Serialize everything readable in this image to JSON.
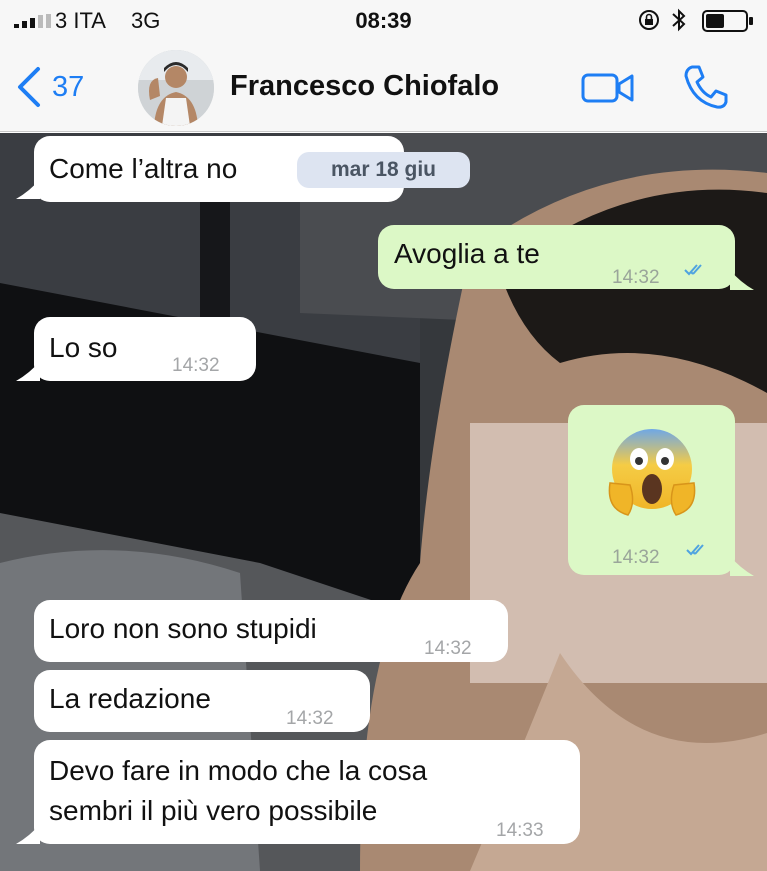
{
  "status_bar": {
    "carrier": "3 ITA",
    "network": "3G",
    "time": "08:39",
    "icons": [
      "signal-icon",
      "orientation-lock-icon",
      "bluetooth-icon",
      "battery-icon"
    ]
  },
  "nav": {
    "back_count": "37",
    "contact_name": "Francesco Chiofalo",
    "icons": [
      "chevron-left-icon",
      "video-call-icon",
      "phone-icon"
    ],
    "accent_color": "#1e7ef4"
  },
  "messages": [
    {
      "direction": "in",
      "text": "Come l’altra no",
      "date_label": "mar 18 giu"
    },
    {
      "direction": "out",
      "text": "Avoglia a te",
      "time": "14:32",
      "status": "read"
    },
    {
      "direction": "in",
      "text": "Lo so",
      "time": "14:32"
    },
    {
      "direction": "out",
      "emoji": "face-screaming-in-fear",
      "time": "14:32",
      "status": "read"
    },
    {
      "direction": "in",
      "text": "Loro non sono stupidi",
      "time": "14:32"
    },
    {
      "direction": "in",
      "text": "La redazione",
      "time": "14:32"
    },
    {
      "direction": "in",
      "text_lines": [
        "Devo fare in modo che la cosa",
        "sembri il più vero possibile"
      ],
      "time": "14:33"
    }
  ],
  "colors": {
    "incoming_bubble": "#ffffff",
    "outgoing_bubble": "#dcf8c6",
    "read_tick": "#4fa3e0",
    "date_pill": "#dde4f1"
  }
}
